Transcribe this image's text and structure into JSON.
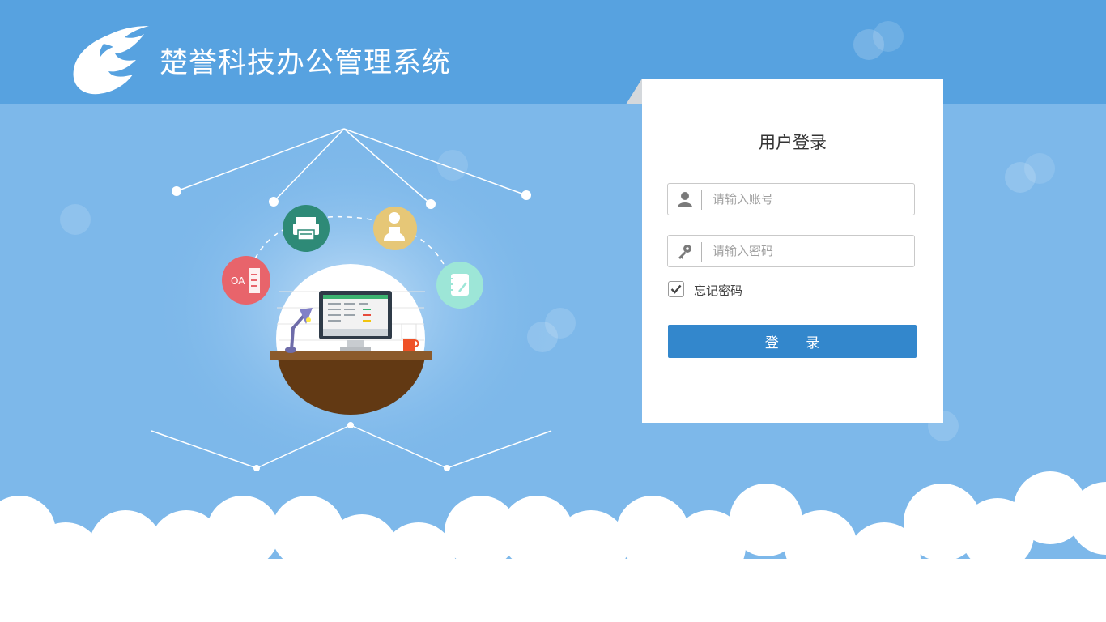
{
  "header": {
    "title": "楚誉科技办公管理系统",
    "logo_icon": "wing-logo-icon"
  },
  "illustration": {
    "badges": [
      {
        "name": "oa-app-icon",
        "text": "OA",
        "color": "#e8646b"
      },
      {
        "name": "printer-icon",
        "color": "#2e8a77"
      },
      {
        "name": "user-profile-icon",
        "color": "#e6c777"
      },
      {
        "name": "notebook-icon",
        "color": "#9de6d7"
      }
    ],
    "scene_icon": "office-desk-monitor-icon"
  },
  "login": {
    "title": "用户登录",
    "username": {
      "placeholder": "请输入账号",
      "value": "",
      "icon": "user-icon"
    },
    "password": {
      "placeholder": "请输入密码",
      "value": "",
      "icon": "key-icon"
    },
    "remember": {
      "label": "忘记密码",
      "checked": true
    },
    "submit_label": "登 录"
  },
  "colors": {
    "header_bg": "#57a2e0",
    "page_bg": "#7db8ea",
    "button_bg": "#3387cc",
    "card_bg": "#ffffff"
  }
}
